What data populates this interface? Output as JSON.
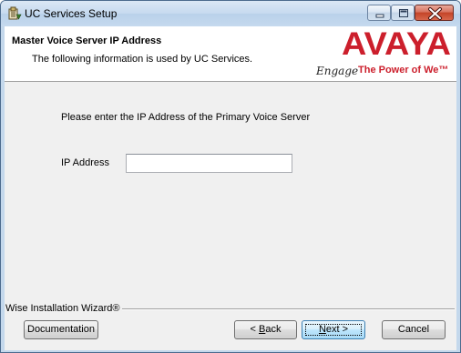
{
  "window": {
    "title": "UC Services Setup"
  },
  "banner": {
    "title": "Master Voice Server IP Address",
    "subtitle": "The following information is used by UC Services.",
    "logo_text": "AVAYA",
    "tagline_script": "Engage",
    "tagline": "The Power of We™"
  },
  "body": {
    "prompt": "Please enter the IP Address of the Primary Voice Server",
    "ip_label": "IP Address",
    "ip_value": "",
    "ip_placeholder": ""
  },
  "footer": {
    "wizard_label": "Wise Installation Wizard®",
    "documentation": "Documentation",
    "back_prefix": "< ",
    "back_hotkey": "B",
    "back_rest": "ack",
    "next_hotkey": "N",
    "next_rest": "ext >",
    "cancel": "Cancel"
  },
  "colors": {
    "avaya_red": "#cc1f2c",
    "title_bar": "#c6daef",
    "dialog_bg": "#f0f0f0"
  },
  "icons": {
    "title": "installer-icon",
    "minimize": "minimize-icon",
    "maximize": "maximize-icon",
    "close": "close-icon"
  }
}
